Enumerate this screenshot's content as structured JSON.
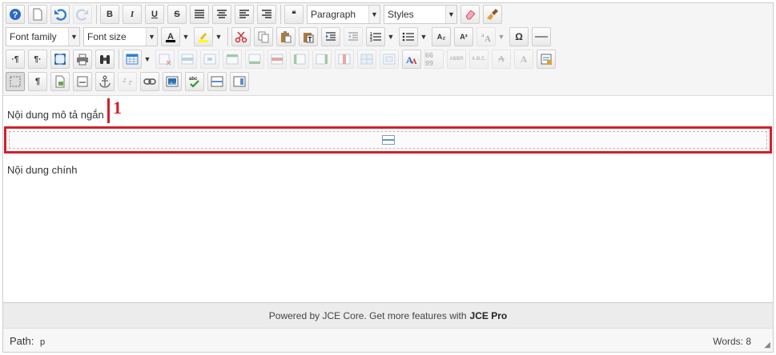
{
  "toolbar": {
    "paragraph_format": "Paragraph",
    "styles": "Styles",
    "font_family": "Font family",
    "font_size": "Font size",
    "labels": {
      "bold": "B",
      "italic": "I",
      "underline": "U",
      "strikethrough": "S",
      "subscript": "A₂",
      "superscript": "A²",
      "special_char": "Ω",
      "pilcrow": "¶",
      "ltr": "·¶",
      "rtl": "¶·",
      "blockquote": "❝",
      "abbr": "ABBR",
      "acronym": "A.B.C."
    },
    "icons": [
      "help-icon",
      "new-document-icon",
      "undo-icon",
      "redo-icon",
      "eraser-icon",
      "brush-icon",
      "cut-icon",
      "copy-icon",
      "paste-icon",
      "paste-text-icon",
      "indent-icon",
      "outdent-icon",
      "numbered-list-icon",
      "bullet-list-icon",
      "font-color-icon",
      "highlight-icon",
      "fullscreen-icon",
      "print-icon",
      "search-icon",
      "table-icon",
      "anchor-icon",
      "link-icon",
      "unlink-icon",
      "image-icon",
      "spellcheck-icon",
      "readmore-icon",
      "pagebreak-icon",
      "visual-aid-icon",
      "template-icon",
      "style-icon",
      "horizontal-rule-icon"
    ],
    "colors": {
      "font_color_bar": "#000000",
      "highlight_bar": "#ffff00"
    }
  },
  "content": {
    "short_description": "Nội dung mô tả ngắn",
    "annotation_number": "1",
    "main_content": "Nội dung chính",
    "accent_color": "#d21f2b"
  },
  "footer": {
    "powered_text": "Powered by JCE Core. Get more features with",
    "pro_link": "JCE Pro"
  },
  "status": {
    "path_label": "Path:",
    "path_value": "p",
    "word_count": "Words: 8"
  }
}
